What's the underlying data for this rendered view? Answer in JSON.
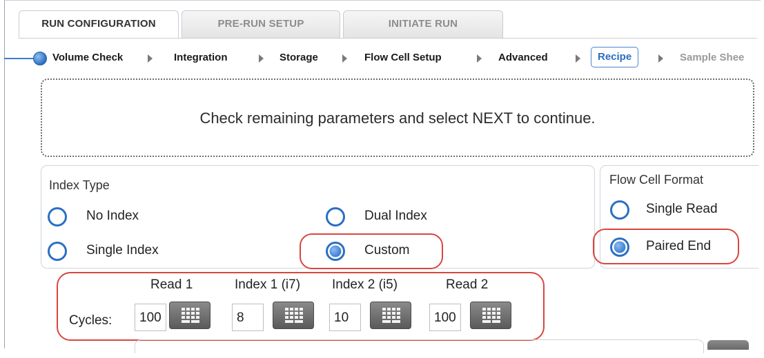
{
  "tabs": [
    {
      "label": "RUN CONFIGURATION",
      "active": true
    },
    {
      "label": "PRE-RUN SETUP",
      "active": false
    },
    {
      "label": "INITIATE RUN",
      "active": false
    }
  ],
  "steps": [
    {
      "label": "Volume Check",
      "state": "done"
    },
    {
      "label": "Integration",
      "state": "done"
    },
    {
      "label": "Storage",
      "state": "done"
    },
    {
      "label": "Flow Cell Setup",
      "state": "done"
    },
    {
      "label": "Advanced",
      "state": "done"
    },
    {
      "label": "Recipe",
      "state": "current"
    },
    {
      "label": "Sample Shee",
      "state": "disabled"
    }
  ],
  "instruction": "Check remaining parameters and select NEXT to continue.",
  "index_type": {
    "title": "Index Type",
    "options": [
      {
        "label": "No Index",
        "checked": false
      },
      {
        "label": "Single Index",
        "checked": false
      },
      {
        "label": "Dual Index",
        "checked": false
      },
      {
        "label": "Custom",
        "checked": true
      }
    ]
  },
  "flow_cell_format": {
    "title": "Flow Cell Format",
    "options": [
      {
        "label": "Single Read",
        "checked": false
      },
      {
        "label": "Paired End",
        "checked": true
      }
    ]
  },
  "cycles": {
    "label": "Cycles:",
    "columns": [
      {
        "header": "Read 1",
        "value": "100"
      },
      {
        "header": "Index 1 (i7)",
        "value": "8"
      },
      {
        "header": "Index 2 (i5)",
        "value": "10"
      },
      {
        "header": "Read 2",
        "value": "100"
      }
    ]
  },
  "colors": {
    "accent": "#2a6fc4",
    "highlight": "#d9453f"
  },
  "icons": {
    "step_marker": "current-step-dot-icon",
    "step_arrow": "chevron-right-icon",
    "keypad": "keypad-icon"
  }
}
